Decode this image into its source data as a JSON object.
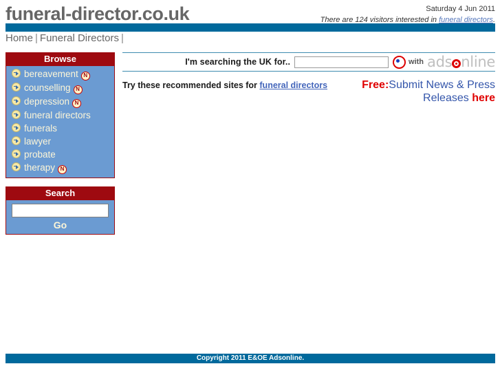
{
  "header": {
    "site_title": "funeral-director.co.uk",
    "date": "Saturday 4 Jun 2011",
    "visitors_prefix": "There are 124 visitors interested in ",
    "visitors_keyword": "funeral directors",
    "visitors_suffix": "."
  },
  "topnav": {
    "items": [
      {
        "label": "Home"
      },
      {
        "label": "Funeral Directors"
      }
    ],
    "separator": "|"
  },
  "sidebar": {
    "browse": {
      "title": "Browse",
      "items": [
        {
          "label": "bereavement",
          "badge": "N"
        },
        {
          "label": "counselling",
          "badge": "N"
        },
        {
          "label": "depression",
          "badge": "N"
        },
        {
          "label": "funeral directors",
          "badge": ""
        },
        {
          "label": "funerals",
          "badge": ""
        },
        {
          "label": "lawyer",
          "badge": ""
        },
        {
          "label": "probate",
          "badge": ""
        },
        {
          "label": "therapy",
          "badge": "N"
        }
      ]
    },
    "search": {
      "title": "Search",
      "input_value": "",
      "input_placeholder": "",
      "go_label": "Go"
    }
  },
  "main": {
    "search_label": "I'm searching the UK for..",
    "search_input_value": "",
    "search_input_placeholder": "",
    "ads_logo": {
      "with_label": "with",
      "brand_part1": "ads",
      "brand_o": "o",
      "brand_part2": "nline"
    },
    "recommend_prefix": "Try these recommended sites for ",
    "recommend_keyword": "funeral directors",
    "promo": {
      "free_label": "Free:",
      "body": "Submit News & Press Releases ",
      "here_label": "here"
    }
  },
  "footer": {
    "copyright": "Copyright 2011 E&OE Adsonline."
  },
  "colors": {
    "brand_blue": "#00699c",
    "panel_red": "#9e0a10",
    "panel_blue": "#6b9bd2",
    "link_blue": "#4466bb",
    "accent_red": "#e00000"
  }
}
